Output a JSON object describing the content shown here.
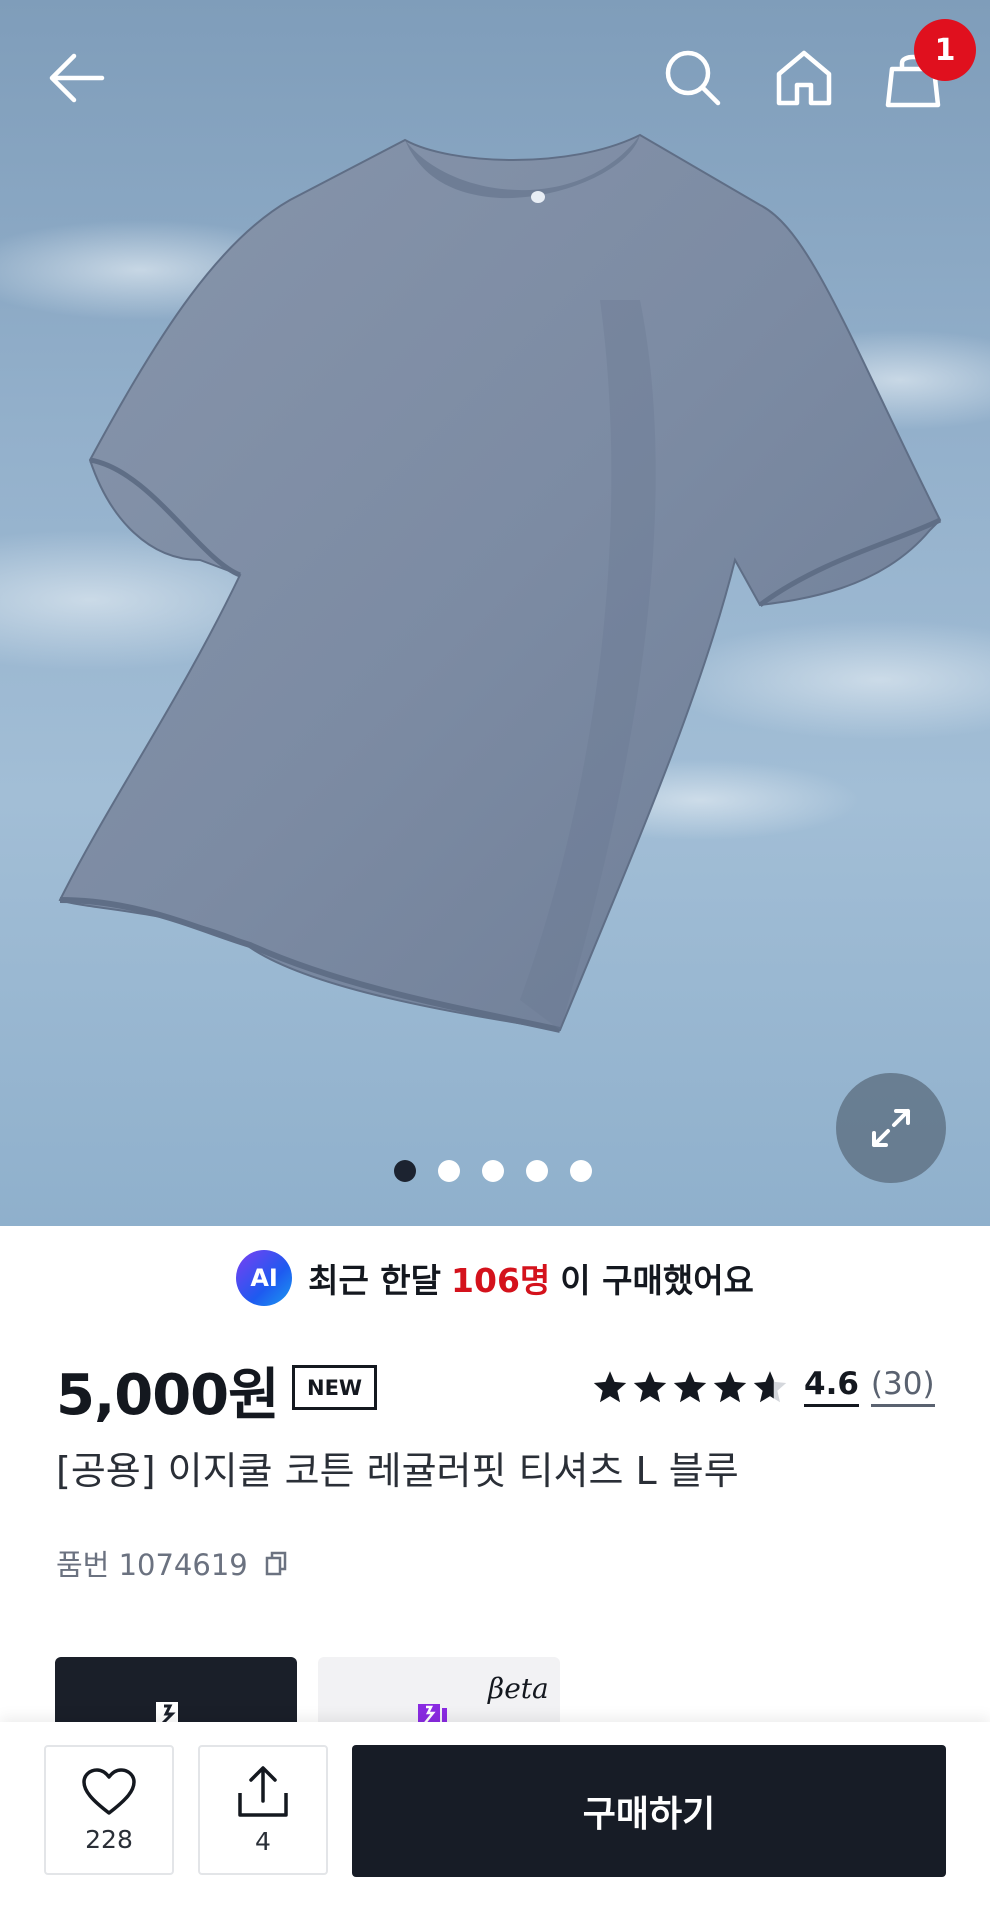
{
  "header": {
    "icons": [
      "back-arrow-icon",
      "search-icon",
      "home-icon",
      "shopping-bag-icon"
    ],
    "cart_badge": "1"
  },
  "gallery": {
    "image": "t-shirt product photo",
    "total_slides": 5,
    "active_slide": 1,
    "expand_icon": "expand-icon"
  },
  "ai_banner": {
    "badge": "AI",
    "prefix": "최근 한달",
    "count": "106명",
    "suffix": "이 구매했어요",
    "highlight_color": "#d4121c"
  },
  "product": {
    "price": "5,000원",
    "badge": "NEW",
    "rating": 4.6,
    "rating_text": "4.6",
    "review_count": "(30)",
    "title": "[공용] 이지쿨 코튼 레귤러핏 티셔츠 L 블루",
    "sku": "품번 1074619"
  },
  "promo_cards": {
    "beta_label": "βeta"
  },
  "bottom_bar": {
    "like_count": "228",
    "share_count": "4",
    "buy_label": "구매하기",
    "buy_color": "#171c26"
  }
}
